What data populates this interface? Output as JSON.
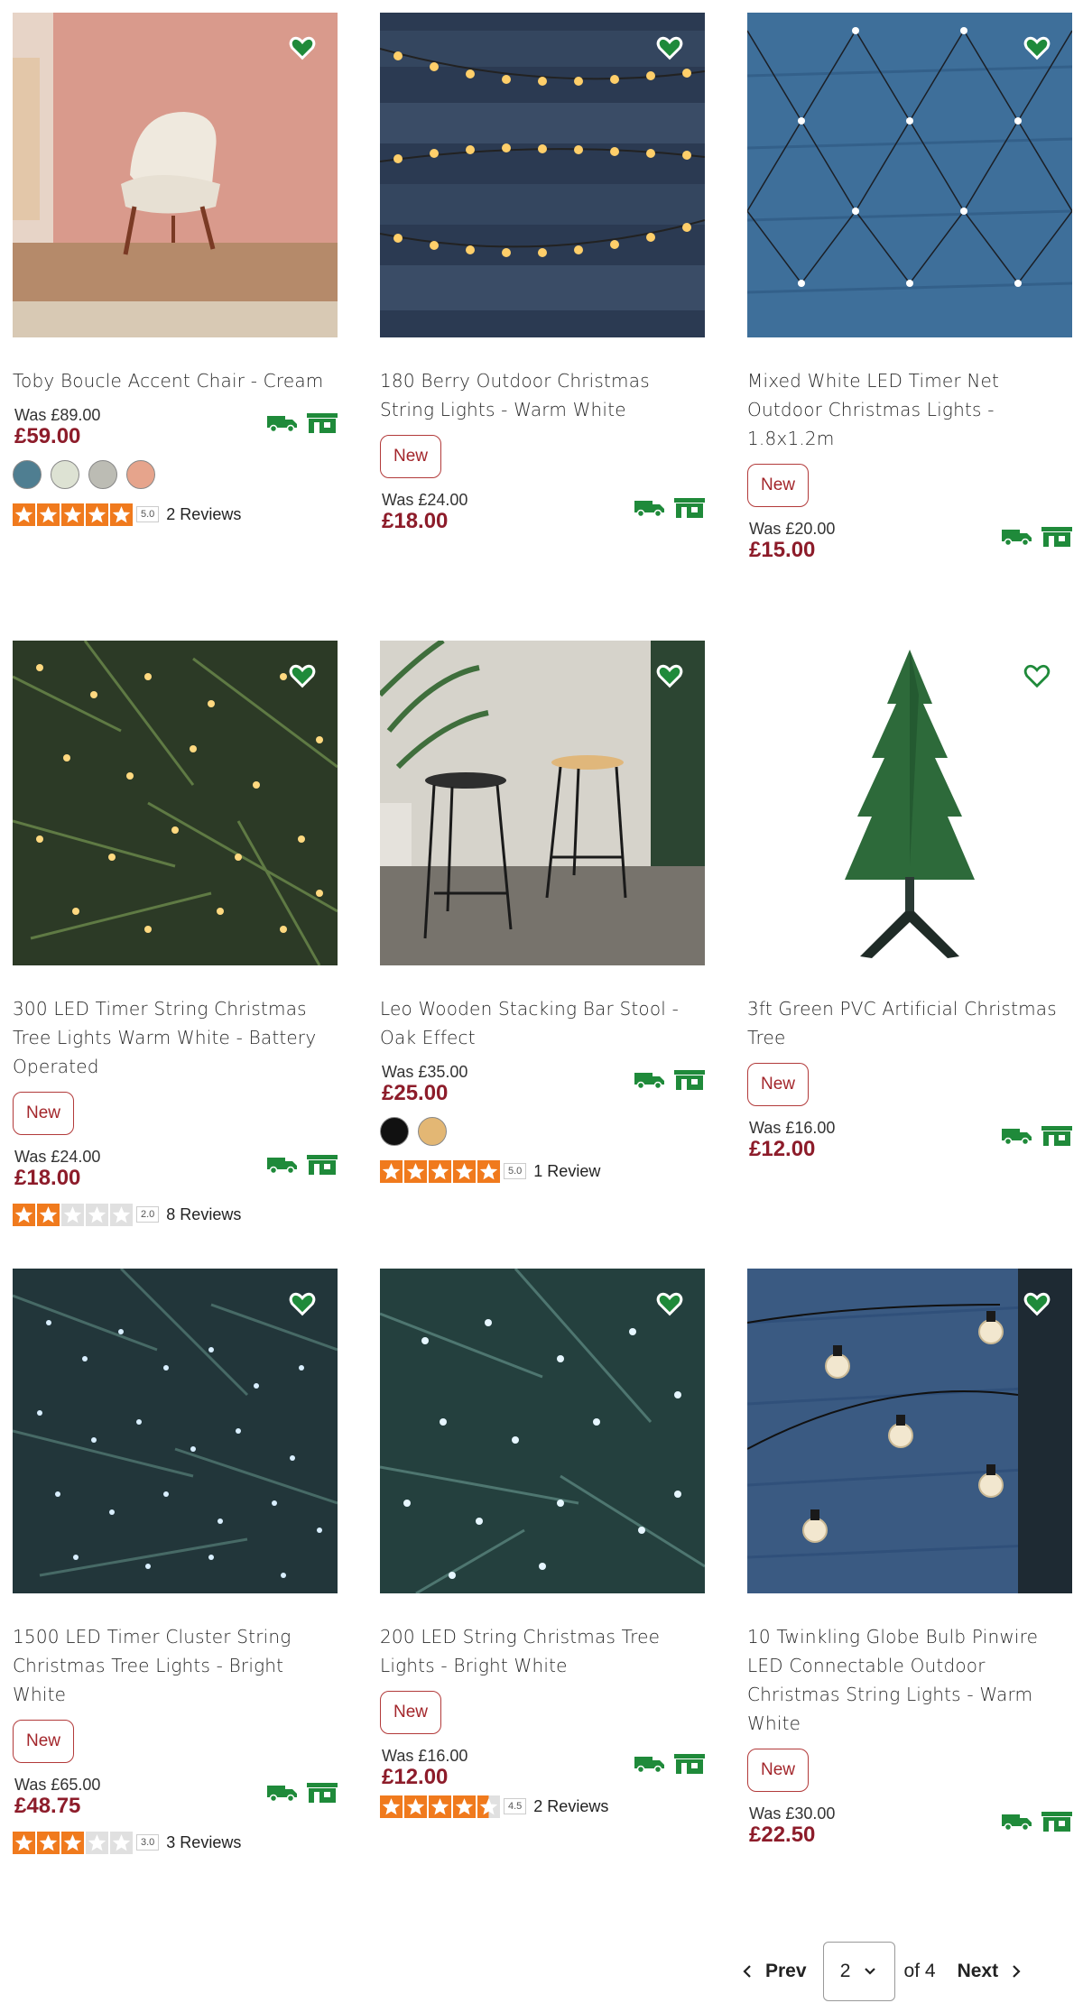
{
  "colors": {
    "accent_green": "#1f8a3a",
    "price_red": "#8d1c2a",
    "badge_red": "#a3262b",
    "star_orange": "#f07a1d",
    "star_empty": "#e0e0e0"
  },
  "products": [
    {
      "title": "Toby Boucle Accent Chair - Cream",
      "badge": "",
      "was": "Was £89.00",
      "price": "£59.00",
      "swatches": [
        "#4f7e91",
        "#dde2d3",
        "#bcbcb4",
        "#e6a48c"
      ],
      "rating": 5.0,
      "score": "5.0",
      "reviews": "2 Reviews",
      "icons": [
        "heart-icon",
        "delivery-van-icon",
        "click-collect-icon"
      ]
    },
    {
      "title": "180 Berry Outdoor Christmas String Lights - Warm White",
      "badge": "New",
      "was": "Was £24.00",
      "price": "£18.00",
      "swatches": [],
      "rating": null,
      "score": "",
      "reviews": ""
    },
    {
      "title": "Mixed White LED Timer Net Outdoor Christmas Lights - 1.8x1.2m",
      "badge": "New",
      "was": "Was £20.00",
      "price": "£15.00",
      "swatches": [],
      "rating": null,
      "score": "",
      "reviews": ""
    },
    {
      "title": "300 LED Timer String Christmas Tree Lights Warm White - Battery Operated",
      "badge": "New",
      "was": "Was £24.00",
      "price": "£18.00",
      "swatches": [],
      "rating": 2.0,
      "score": "2.0",
      "reviews": "8 Reviews"
    },
    {
      "title": "Leo Wooden Stacking Bar Stool - Oak Effect",
      "badge": "",
      "was": "Was £35.00",
      "price": "£25.00",
      "swatches": [
        "#111111",
        "#e3b774"
      ],
      "rating": 5.0,
      "score": "5.0",
      "reviews": "1 Review"
    },
    {
      "title": "3ft Green PVC Artificial Christmas Tree",
      "badge": "New",
      "was": "Was £16.00",
      "price": "£12.00",
      "swatches": [],
      "rating": null,
      "score": "",
      "reviews": ""
    },
    {
      "title": "1500 LED Timer Cluster String Christmas Tree Lights - Bright White",
      "badge": "New",
      "was": "Was £65.00",
      "price": "£48.75",
      "swatches": [],
      "rating": 3.0,
      "score": "3.0",
      "reviews": "3 Reviews"
    },
    {
      "title": "200 LED String Christmas Tree Lights - Bright White",
      "badge": "New",
      "was": "Was £16.00",
      "price": "£12.00",
      "swatches": [],
      "rating": 4.5,
      "score": "4.5",
      "reviews": "2 Reviews"
    },
    {
      "title": "10 Twinkling Globe Bulb Pinwire LED Connectable Outdoor Christmas String Lights - Warm White",
      "badge": "New",
      "was": "Was £30.00",
      "price": "£22.50",
      "swatches": [],
      "rating": null,
      "score": "",
      "reviews": ""
    }
  ],
  "pagination": {
    "prev_label": "Prev",
    "current_page": "2",
    "of_label": "of 4",
    "next_label": "Next"
  }
}
